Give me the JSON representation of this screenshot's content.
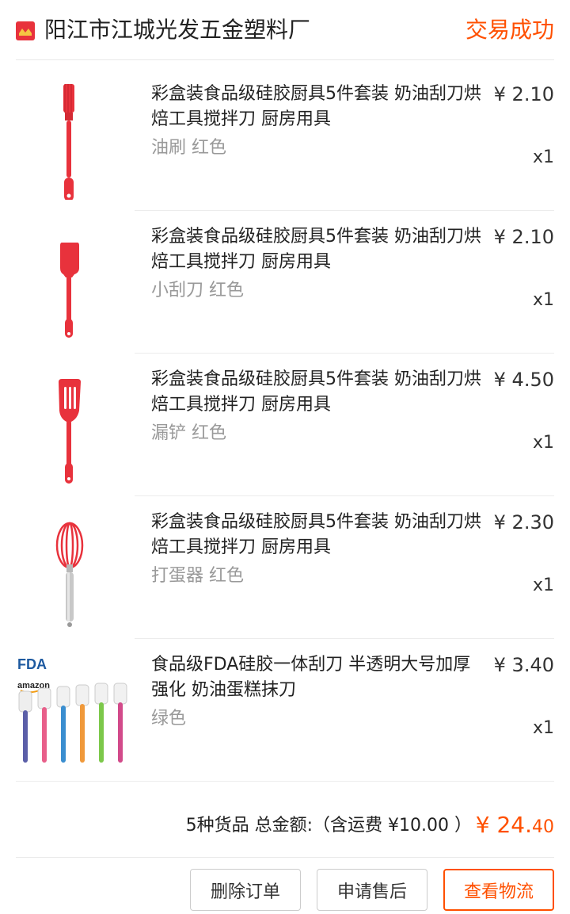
{
  "header": {
    "shop_name": "阳江市江城光发五金塑料厂",
    "status": "交易成功",
    "shop_icon": "shop-badge-icon"
  },
  "items": [
    {
      "title": "彩盒装食品级硅胶厨具5件套装 奶油刮刀烘焙工具搅拌刀 厨房用具",
      "sku": "油刷 红色",
      "price": "¥ 2.10",
      "qty": "x1",
      "image": "red-silicone-brush"
    },
    {
      "title": "彩盒装食品级硅胶厨具5件套装 奶油刮刀烘焙工具搅拌刀 厨房用具",
      "sku": "小刮刀 红色",
      "price": "¥ 2.10",
      "qty": "x1",
      "image": "red-silicone-spatula"
    },
    {
      "title": "彩盒装食品级硅胶厨具5件套装 奶油刮刀烘焙工具搅拌刀 厨房用具",
      "sku": "漏铲 红色",
      "price": "¥ 4.50",
      "qty": "x1",
      "image": "red-slotted-turner"
    },
    {
      "title": "彩盒装食品级硅胶厨具5件套装 奶油刮刀烘焙工具搅拌刀 厨房用具",
      "sku": "打蛋器 红色",
      "price": "¥ 2.30",
      "qty": "x1",
      "image": "red-whisk"
    },
    {
      "title": "食品级FDA硅胶一体刮刀 半透明大号加厚强化 奶油蛋糕抹刀",
      "sku": "绿色",
      "price": "¥ 3.40",
      "qty": "x1",
      "image": "translucent-spatula-set",
      "logo_text_1": "FDA",
      "logo_text_2": "amazon"
    }
  ],
  "summary": {
    "text": "5种货品 总金额:（含运费 ¥10.00 ）",
    "total_main": "¥ 24.",
    "total_cents": "40"
  },
  "actions": {
    "delete_label": "删除订单",
    "aftersale_label": "申请售后",
    "logistics_label": "查看物流"
  },
  "colors": {
    "accent": "#ff5000",
    "product_red": "#e8323c"
  }
}
